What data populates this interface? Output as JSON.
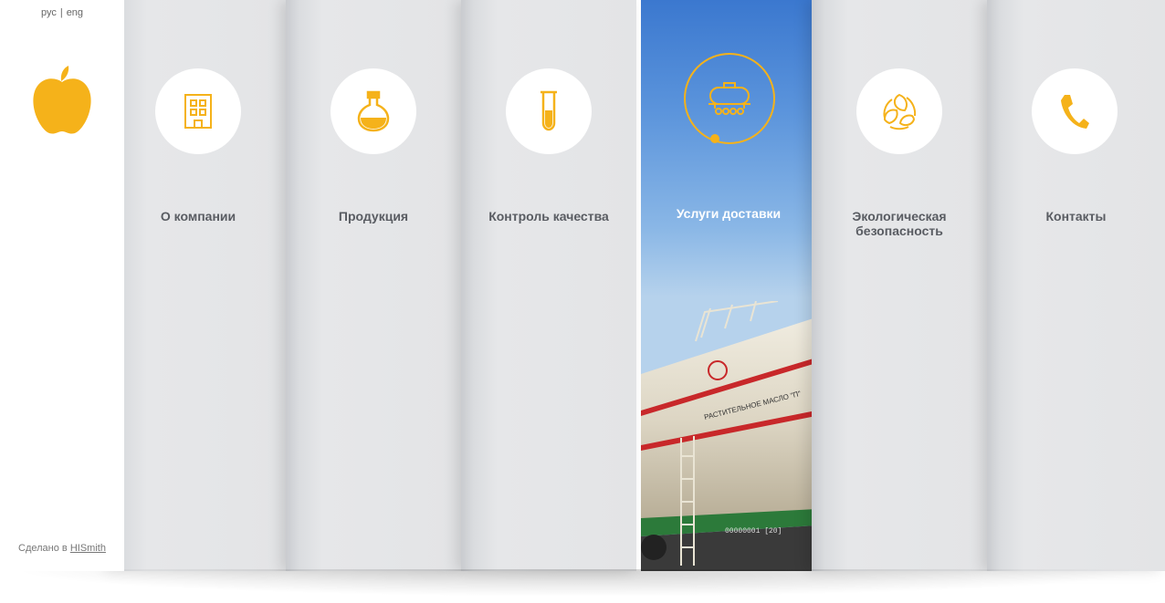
{
  "lang": {
    "ru": "рус",
    "separator": "|",
    "en": "eng"
  },
  "footer": {
    "prefix": "Сделано в ",
    "link": "HISmith"
  },
  "menu": {
    "items": [
      {
        "label": "О компании",
        "icon": "building-icon"
      },
      {
        "label": "Продукция",
        "icon": "flask-icon"
      },
      {
        "label": "Контроль качества",
        "icon": "test-tube-icon"
      },
      {
        "label": "Услуги доставки",
        "icon": "tank-car-icon",
        "active": true
      },
      {
        "label": "Экологическая безопасность",
        "icon": "recycle-leaves-icon"
      },
      {
        "label": "Контакты",
        "icon": "phone-icon"
      }
    ]
  },
  "photo": {
    "tank_text": "РАСТИТЕЛЬНОЕ МАСЛО \"П\"",
    "number": "00000001 [20]"
  },
  "colors": {
    "accent": "#f5b21a",
    "label": "#595c62",
    "active_label": "#ffffff"
  }
}
